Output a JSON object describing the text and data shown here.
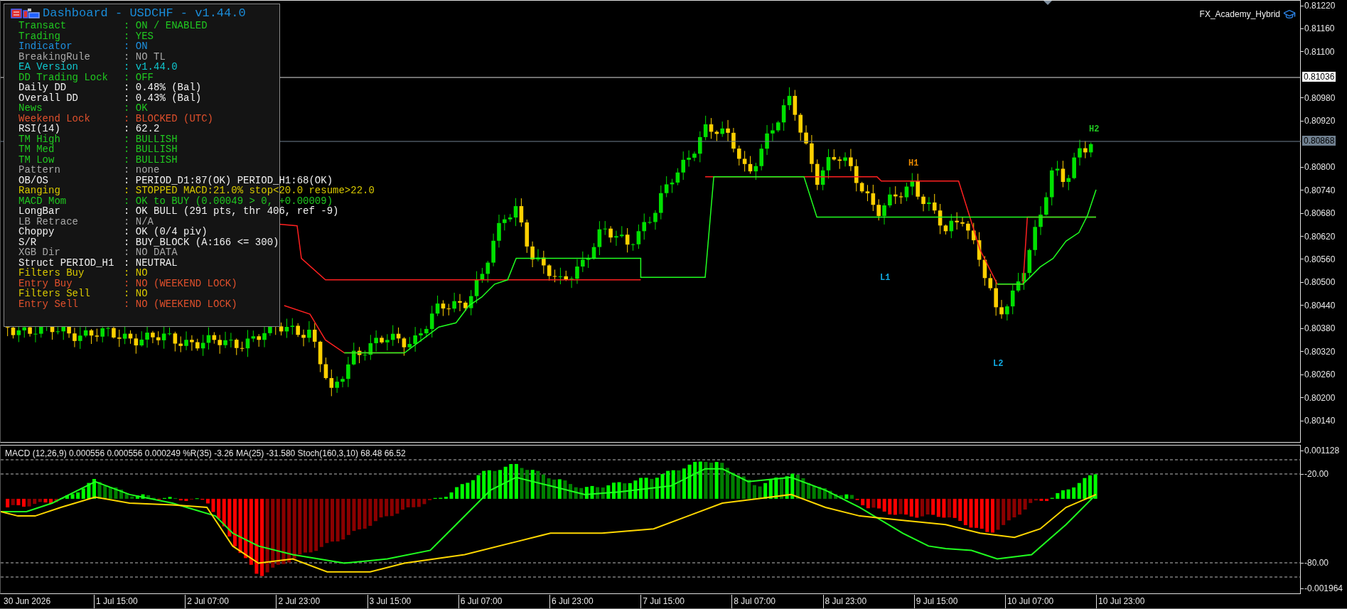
{
  "dashboard": {
    "title": "Dashboard - USDCHF - v1.44.0",
    "rows": [
      {
        "label": "Transact",
        "value": ": ON / ENABLED",
        "color": "#20c820"
      },
      {
        "label": "Trading",
        "value": ": YES",
        "color": "#20c820"
      },
      {
        "label": "Indicator",
        "value": ": ON",
        "color": "#1e90e0"
      },
      {
        "label": "BreakingRule",
        "value": ": NO TL",
        "color": "#a8a8a8"
      },
      {
        "label": "EA Version",
        "value": ": v1.44.0",
        "color": "#10c8d0"
      },
      {
        "label": "DD Trading Lock",
        "value": ": OFF",
        "color": "#20c820"
      },
      {
        "label": "Daily DD",
        "value": ": 0.48% (Bal)",
        "color": "#f0f0f0"
      },
      {
        "label": "Overall DD",
        "value": ": 0.43% (Bal)",
        "color": "#f0f0f0"
      },
      {
        "label": "News",
        "value": ": OK",
        "color": "#20c820"
      },
      {
        "label": "Weekend Lock",
        "value": ": BLOCKED (UTC)",
        "color": "#e0502c"
      },
      {
        "label": "RSI(14)",
        "value": ": 62.2",
        "color": "#f0f0f0"
      },
      {
        "label": "TM High",
        "value": ": BULLISH",
        "color": "#20c820"
      },
      {
        "label": "TM Med",
        "value": ": BULLISH",
        "color": "#20c820"
      },
      {
        "label": "TM Low",
        "value": ": BULLISH",
        "color": "#20c820"
      },
      {
        "label": "Pattern",
        "value": ": none",
        "color": "#a8a8a8"
      },
      {
        "label": "OB/OS",
        "value": ": PERIOD_D1:87(OK) PERIOD_H1:68(OK)",
        "color": "#f0f0f0"
      },
      {
        "label": "Ranging",
        "value": ": STOPPED MACD:21.0% stop<20.0 resume>22.0",
        "color": "#d8c800"
      },
      {
        "label": "MACD Mom",
        "value": ": OK to BUY (0.00049 > 0, +0.00009)",
        "color": "#20c820"
      },
      {
        "label": "LongBar",
        "value": ": OK BULL (291 pts, thr 406, ref -9)",
        "color": "#f0f0f0"
      },
      {
        "label": "LB Retrace",
        "value": ": N/A",
        "color": "#a8a8a8"
      },
      {
        "label": "Choppy",
        "value": ": OK (0/4 piv)",
        "color": "#f0f0f0"
      },
      {
        "label": "S/R",
        "value": ": BUY_BLOCK (A:166 <= 300)",
        "color": "#f0f0f0"
      },
      {
        "label": "XGB Dir",
        "value": ": NO DATA",
        "color": "#a8a8a8"
      },
      {
        "label": "Struct PERIOD_H1",
        "value": ": NEUTRAL",
        "color": "#f0f0f0"
      },
      {
        "label": "Filters Buy",
        "value": ": NO",
        "color": "#d8c800"
      },
      {
        "label": "Entry Buy",
        "value": ": NO (WEEKEND LOCK)",
        "color": "#e0502c"
      },
      {
        "label": "Filters Sell",
        "value": ": NO",
        "color": "#d8c800"
      },
      {
        "label": "Entry Sell",
        "value": ": NO (WEEKEND LOCK)",
        "color": "#e0502c"
      }
    ]
  },
  "expert_name": "FX_Academy_Hybrid",
  "swing_labels": [
    {
      "text": "H1",
      "color": "#e88a00"
    },
    {
      "text": "H2",
      "color": "#20c820"
    },
    {
      "text": "L1",
      "color": "#10a8e0"
    },
    {
      "text": "L2",
      "color": "#10a8e0"
    }
  ],
  "price_axis": {
    "ticks": [
      "0.81220",
      "0.81160",
      "0.81100",
      "0.80980",
      "0.80920",
      "0.80800",
      "0.80740",
      "0.80680",
      "0.80620",
      "0.80560",
      "0.80500",
      "0.80440",
      "0.80380",
      "0.80320",
      "0.80260",
      "0.80200",
      "0.80140"
    ],
    "markers": [
      {
        "value": "0.81036",
        "kind": "line"
      },
      {
        "value": "0.80868",
        "kind": "bid"
      }
    ]
  },
  "indicator_pane": {
    "legend": "MACD (12,26,9) 0.000556 0.000556 0.000249 %R(35) -3.26 MA(25) -31.580 Stoch(160,3,10) 68.48 66.52",
    "axis": [
      "0.001128",
      "-20.00",
      "-80.00",
      "-0.001964"
    ]
  },
  "time_axis": [
    "30 Jun 2026",
    "1 Jul 15:00",
    "2 Jul 07:00",
    "2 Jul 23:00",
    "3 Jul 15:00",
    "6 Jul 07:00",
    "6 Jul 23:00",
    "7 Jul 15:00",
    "8 Jul 07:00",
    "8 Jul 23:00",
    "9 Jul 15:00",
    "10 Jul 07:00",
    "10 Jul 23:00"
  ]
}
